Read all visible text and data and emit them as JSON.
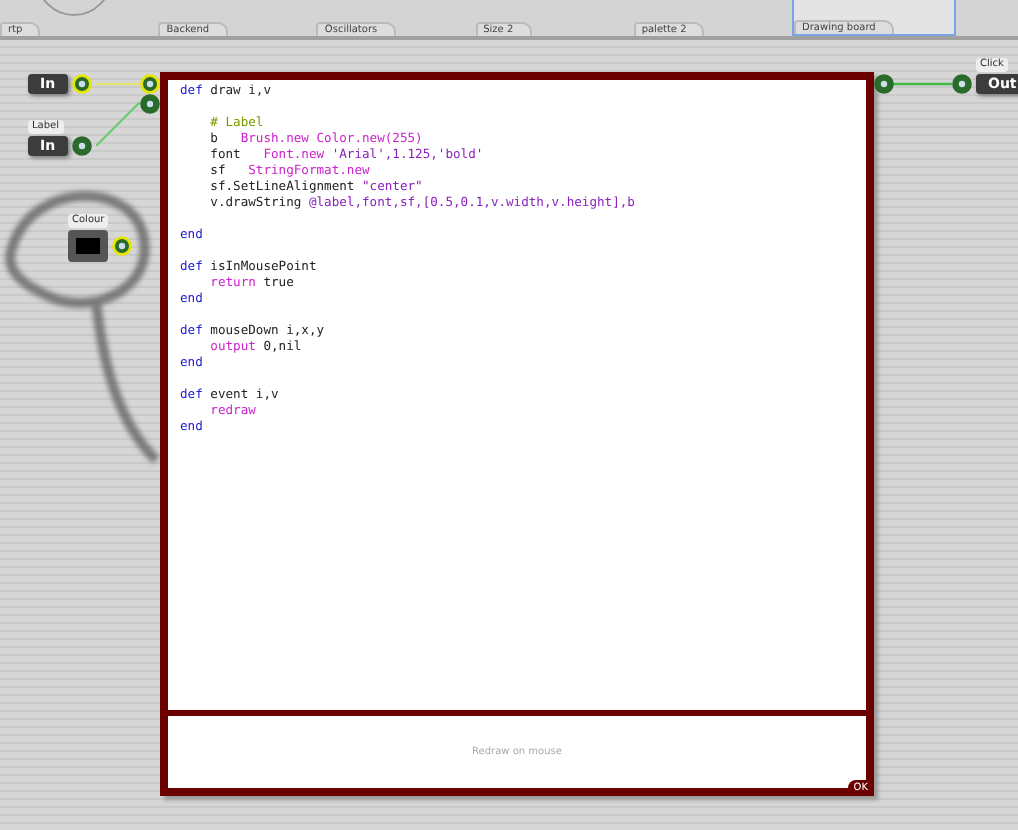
{
  "tabs": [
    {
      "label": "rtp"
    },
    {
      "label": "Backend"
    },
    {
      "label": "Oscillators"
    },
    {
      "label": "Size 2"
    },
    {
      "label": "palette 2"
    },
    {
      "label": "Drawing board"
    }
  ],
  "nodes": [
    {
      "kind": "input",
      "label": "In"
    },
    {
      "kind": "input",
      "tag": "Label",
      "label": "In"
    },
    {
      "kind": "colour",
      "tag": "Colour"
    },
    {
      "kind": "output",
      "tag": "Click",
      "label": "Out"
    }
  ],
  "code": [
    {
      "kind": "code",
      "segments": [
        {
          "kind": "keyword",
          "text": "def"
        },
        {
          "kind": "plain",
          "text": " draw i,v"
        }
      ]
    },
    {
      "kind": "blank"
    },
    {
      "kind": "code",
      "segments": [
        {
          "kind": "comment",
          "text": "    # Label"
        }
      ]
    },
    {
      "kind": "code",
      "segments": [
        {
          "kind": "plain",
          "text": "    b   "
        },
        {
          "kind": "class",
          "text": "Brush.new Color.new(255)"
        }
      ]
    },
    {
      "kind": "code",
      "segments": [
        {
          "kind": "plain",
          "text": "    font   "
        },
        {
          "kind": "class",
          "text": "Font.new "
        },
        {
          "kind": "string",
          "text": "'Arial',1.125,'bold'"
        }
      ]
    },
    {
      "kind": "code",
      "segments": [
        {
          "kind": "plain",
          "text": "    sf   "
        },
        {
          "kind": "class",
          "text": "StringFormat.new"
        }
      ]
    },
    {
      "kind": "code",
      "segments": [
        {
          "kind": "plain",
          "text": "    sf.SetLineAlignment "
        },
        {
          "kind": "string",
          "text": "\"center\""
        }
      ]
    },
    {
      "kind": "code",
      "segments": [
        {
          "kind": "plain",
          "text": "    v.drawString "
        },
        {
          "kind": "string",
          "text": "@label,font,sf,[0.5,0.1,v.width,v.height],b"
        }
      ]
    },
    {
      "kind": "blank"
    },
    {
      "kind": "code",
      "segments": [
        {
          "kind": "keyword",
          "text": "end"
        }
      ]
    },
    {
      "kind": "blank"
    },
    {
      "kind": "code",
      "segments": [
        {
          "kind": "keyword",
          "text": "def"
        },
        {
          "kind": "plain",
          "text": " isInMousePoint"
        }
      ]
    },
    {
      "kind": "code",
      "segments": [
        {
          "kind": "class",
          "text": "    return"
        },
        {
          "kind": "plain",
          "text": " true"
        }
      ]
    },
    {
      "kind": "code",
      "segments": [
        {
          "kind": "keyword",
          "text": "end"
        }
      ]
    },
    {
      "kind": "blank"
    },
    {
      "kind": "code",
      "segments": [
        {
          "kind": "keyword",
          "text": "def"
        },
        {
          "kind": "plain",
          "text": " mouseDown i,x,y"
        }
      ]
    },
    {
      "kind": "code",
      "segments": [
        {
          "kind": "class",
          "text": "    output"
        },
        {
          "kind": "plain",
          "text": " 0,nil"
        }
      ]
    },
    {
      "kind": "code",
      "segments": [
        {
          "kind": "keyword",
          "text": "end"
        }
      ]
    },
    {
      "kind": "blank"
    },
    {
      "kind": "code",
      "segments": [
        {
          "kind": "keyword",
          "text": "def"
        },
        {
          "kind": "plain",
          "text": " event i,v"
        }
      ]
    },
    {
      "kind": "code",
      "segments": [
        {
          "kind": "class",
          "text": "    redraw"
        }
      ]
    },
    {
      "kind": "code",
      "segments": [
        {
          "kind": "keyword",
          "text": "end"
        }
      ]
    }
  ],
  "footer": "Redraw on mouse",
  "corner_badge": "OK"
}
